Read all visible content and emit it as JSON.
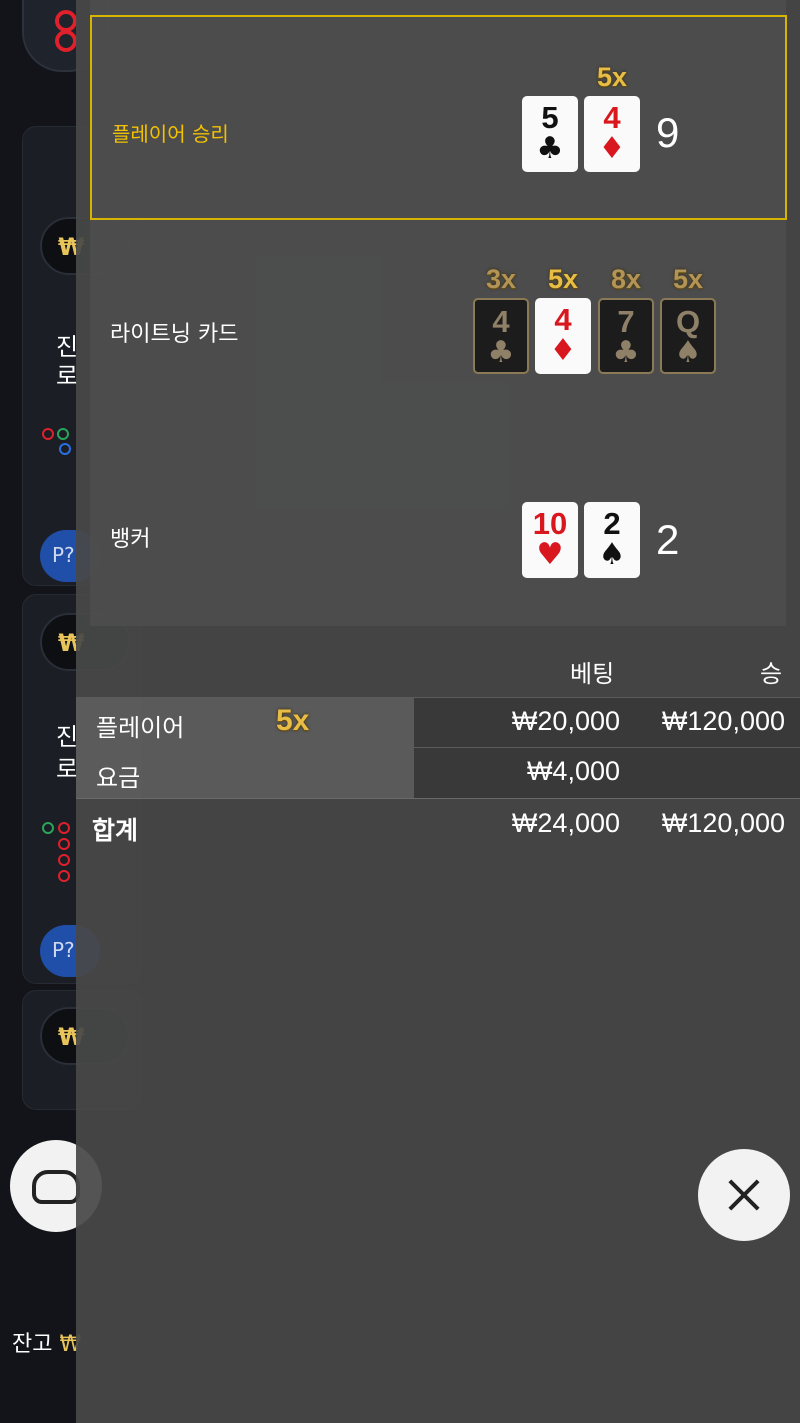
{
  "background": {
    "amounts": [
      "₩",
      "₩",
      "₩"
    ],
    "side_texts": [
      [
        "진",
        "로"
      ],
      [
        "진",
        "로"
      ]
    ],
    "roadmap_badges": [
      "P?",
      "P?"
    ],
    "balance_label": "잔고",
    "balance_value": "₩"
  },
  "result": {
    "player_row": {
      "label": "플레이어 승리",
      "cards": [
        {
          "rank": "5",
          "suit": "♣",
          "color": "black"
        },
        {
          "rank": "4",
          "suit": "♦",
          "color": "red",
          "multiplier": "5x"
        }
      ],
      "total": "9"
    },
    "lightning_row": {
      "label": "라이트닝 카드",
      "cards": [
        {
          "rank": "4",
          "suit": "♣",
          "multiplier": "3x",
          "highlighted": false
        },
        {
          "rank": "4",
          "suit": "♦",
          "multiplier": "5x",
          "highlighted": true
        },
        {
          "rank": "7",
          "suit": "♣",
          "multiplier": "8x",
          "highlighted": false
        },
        {
          "rank": "Q",
          "suit": "♠",
          "multiplier": "5x",
          "highlighted": false
        }
      ]
    },
    "banker_row": {
      "label": "뱅커",
      "cards": [
        {
          "rank": "10",
          "suit": "♥",
          "color": "red"
        },
        {
          "rank": "2",
          "suit": "♠",
          "color": "black"
        }
      ],
      "total": "2"
    }
  },
  "bets": {
    "header_bet": "베팅",
    "header_win": "승",
    "rows": [
      {
        "name": "플레이어",
        "multiplier": "5x",
        "bet": "₩20,000",
        "win": "₩120,000"
      },
      {
        "name": "요금",
        "multiplier": "",
        "bet": "₩4,000",
        "win": ""
      }
    ],
    "total": {
      "name": "합계",
      "bet": "₩24,000",
      "win": "₩120,000"
    }
  },
  "close_icon": "close-icon",
  "colors": {
    "gold": "#e8bd45",
    "highlight_border": "#d6b400",
    "red_suit": "#d9171f"
  }
}
